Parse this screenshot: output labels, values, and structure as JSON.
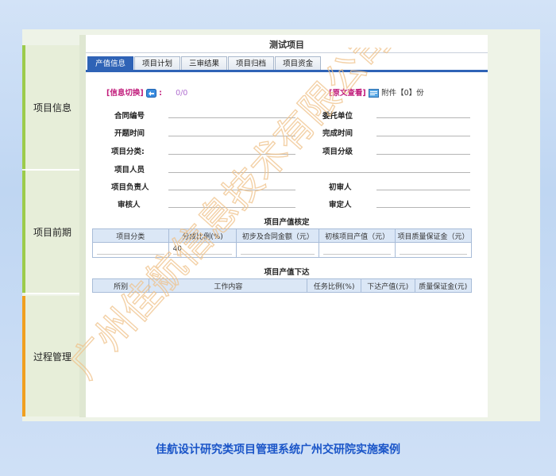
{
  "sidebar": {
    "items": [
      {
        "label": "项目信息"
      },
      {
        "label": "项目前期"
      },
      {
        "label": "过程管理"
      }
    ]
  },
  "main": {
    "title": "测试项目",
    "tabs": [
      {
        "label": "产值信息",
        "active": true
      },
      {
        "label": "项目计划"
      },
      {
        "label": "三审结果"
      },
      {
        "label": "项目归档"
      },
      {
        "label": "项目资金"
      }
    ],
    "info_toggle": {
      "label": "[信息切换]",
      "separator": ":",
      "value": "0/0"
    },
    "original_view": {
      "label": "[原文查看]",
      "attachment_text": "附件【0】份"
    },
    "fields": {
      "contract_no": "合同编号",
      "client": "委托单位",
      "start_time": "开题时间",
      "finish_time": "完成时间",
      "project_category": "项目分类:",
      "project_level": "项目分级",
      "members": "项目人员",
      "leader": "项目负责人",
      "first_reviewer": "初审人",
      "reviewer": "审核人",
      "approver": "审定人"
    },
    "value_check": {
      "title": "项目产值核定",
      "headers": [
        "项目分类",
        "分成比例(%)",
        "初步及合同金额（元）",
        "初核项目产值（元）",
        "项目质量保证金（元）"
      ],
      "rows": [
        [
          "",
          "40",
          "",
          "",
          ""
        ]
      ]
    },
    "value_issue": {
      "title": "项目产值下达",
      "headers": [
        "所别",
        "工作内容",
        "任务比例(%)",
        "下达产值(元)",
        "质量保证金(元)"
      ]
    }
  },
  "watermark": "广州佳航信息技术有限公司",
  "caption": "佳航设计研究类项目管理系统广州交研院实施案例",
  "colors": {
    "accent": "#2f63b6",
    "sidebar_green": "#9ccb4b",
    "sidebar_orange": "#f0a020",
    "magenta": "#c01a7a",
    "caption": "#1a55c8"
  }
}
